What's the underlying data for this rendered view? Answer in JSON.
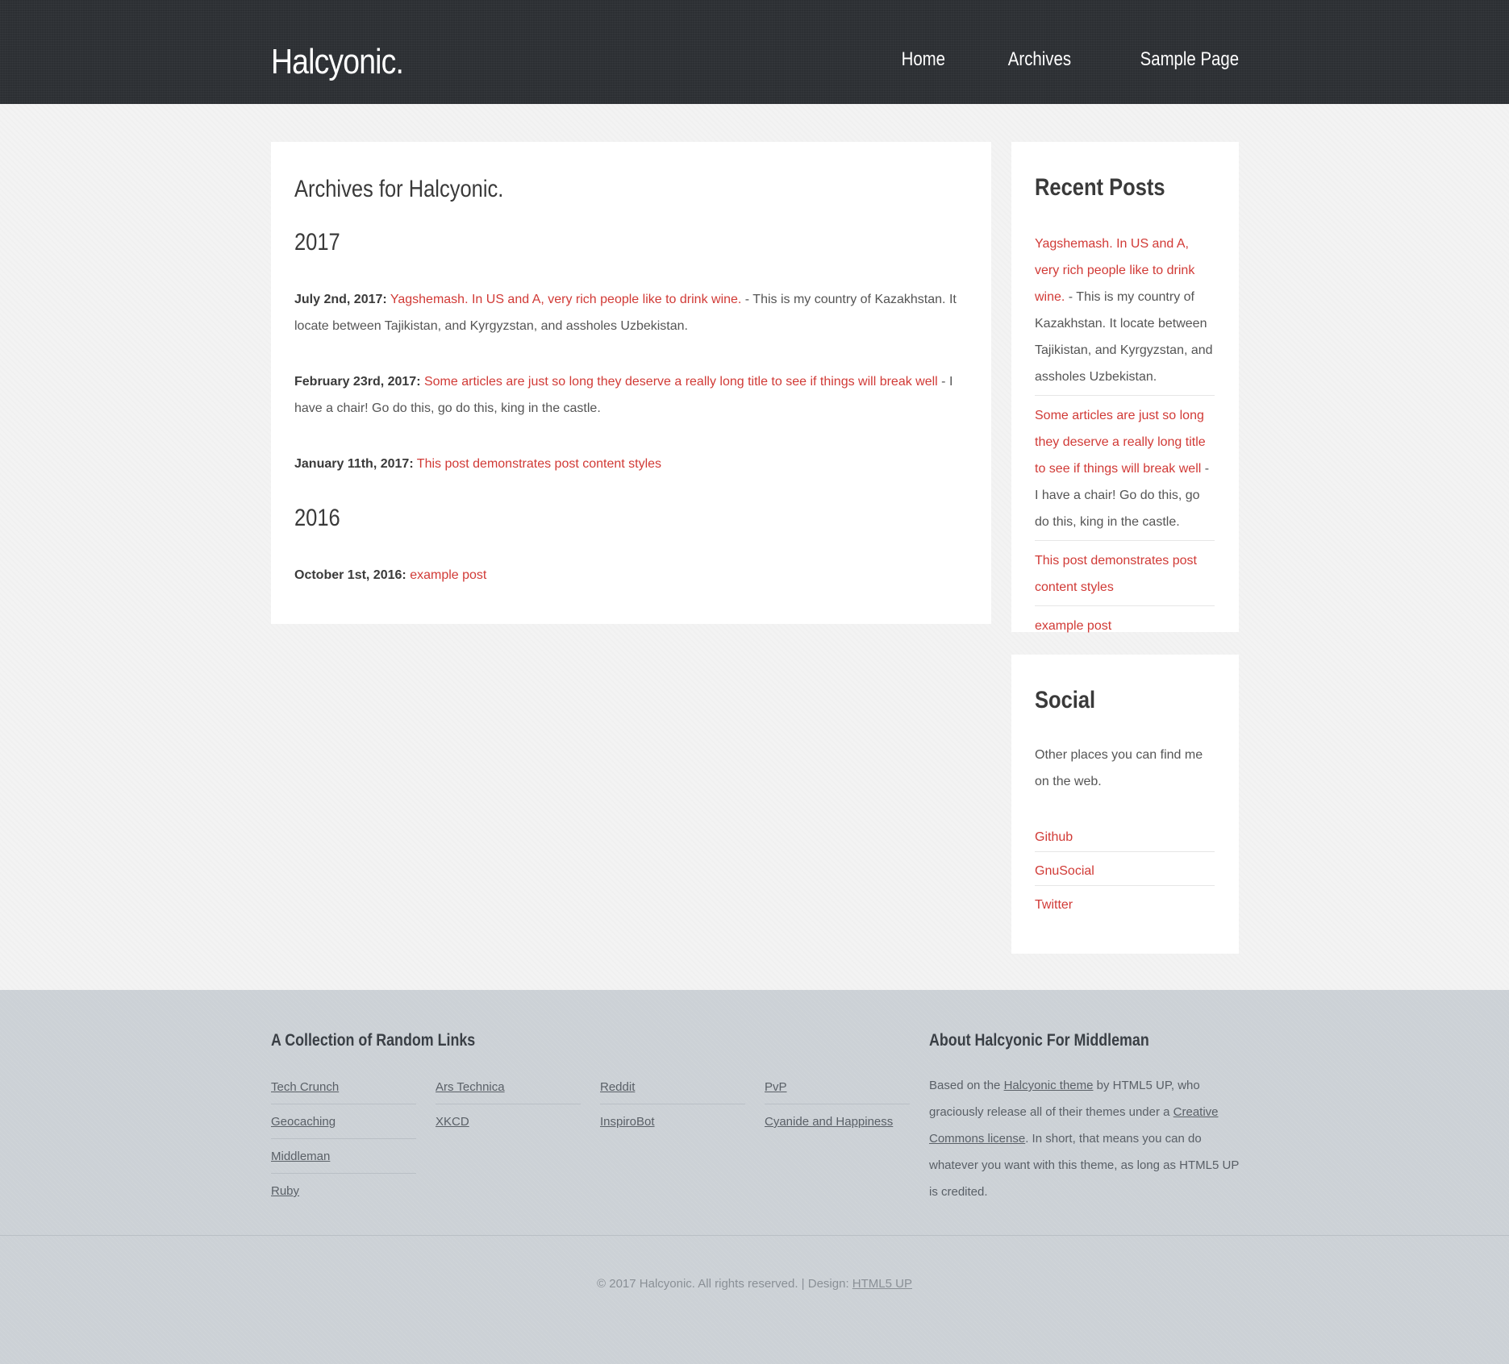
{
  "site": {
    "logo": "Halcyonic."
  },
  "nav": {
    "items": [
      "Home",
      "Archives",
      "Sample Page"
    ]
  },
  "main": {
    "title": "Archives for Halcyonic.",
    "years": [
      {
        "year": "2017",
        "posts": [
          {
            "date": "July 2nd, 2017:",
            "title": "Yagshemash. In US and A, very rich people like to drink wine.",
            "excerpt": " - This is my country of Kazakhstan. It locate between Tajikistan, and Kyrgyzstan, and assholes Uzbekistan."
          },
          {
            "date": "February 23rd, 2017:",
            "title": "Some articles are just so long they deserve a really long title to see if things will break well",
            "excerpt": " - I have a chair! Go do this, go do this, king in the castle."
          },
          {
            "date": "January 11th, 2017:",
            "title": "This post demonstrates post content styles",
            "excerpt": ""
          }
        ]
      },
      {
        "year": "2016",
        "posts": [
          {
            "date": "October 1st, 2016:",
            "title": "example post",
            "excerpt": ""
          }
        ]
      }
    ]
  },
  "recent": {
    "title": "Recent Posts",
    "items": [
      {
        "title": "Yagshemash. In US and A, very rich people like to drink wine.",
        "excerpt": " - This is my country of Kazakhstan. It locate between Tajikistan, and Kyrgyzstan, and assholes Uzbekistan."
      },
      {
        "title": "Some articles are just so long they deserve a really long title to see if things will break well",
        "excerpt": " - I have a chair! Go do this, go do this, king in the castle."
      },
      {
        "title": "This post demonstrates post content styles",
        "excerpt": ""
      },
      {
        "title": "example post",
        "excerpt": ""
      }
    ]
  },
  "social": {
    "title": "Social",
    "text": "Other places you can find me on the web.",
    "links": [
      "Github",
      "GnuSocial",
      "Twitter"
    ]
  },
  "footer": {
    "links_title": "A Collection of Random Links",
    "link_columns": [
      [
        "Tech Crunch",
        "Geocaching",
        "Middleman",
        "Ruby"
      ],
      [
        "Ars Technica",
        "XKCD"
      ],
      [
        "Reddit",
        "InspiroBot"
      ],
      [
        "PvP",
        "Cyanide and Happiness"
      ]
    ],
    "about_title": "About Halcyonic For Middleman",
    "about": {
      "t1": "Based on the ",
      "link1": "Halcyonic theme",
      "t2": " by HTML5 UP, who graciously release all of their themes under a ",
      "link2": "Creative Commons license",
      "t3": ". In short, that means you can do whatever you want with this theme, as long as HTML5 UP is credited."
    },
    "copyright": "© 2017 Halcyonic. All rights reserved. | Design: ",
    "design_link": "HTML5 UP"
  },
  "colors": {
    "accent": "#d13a36",
    "header_bg": "#2c2f33",
    "footer_bg": "#ccd1d6"
  }
}
